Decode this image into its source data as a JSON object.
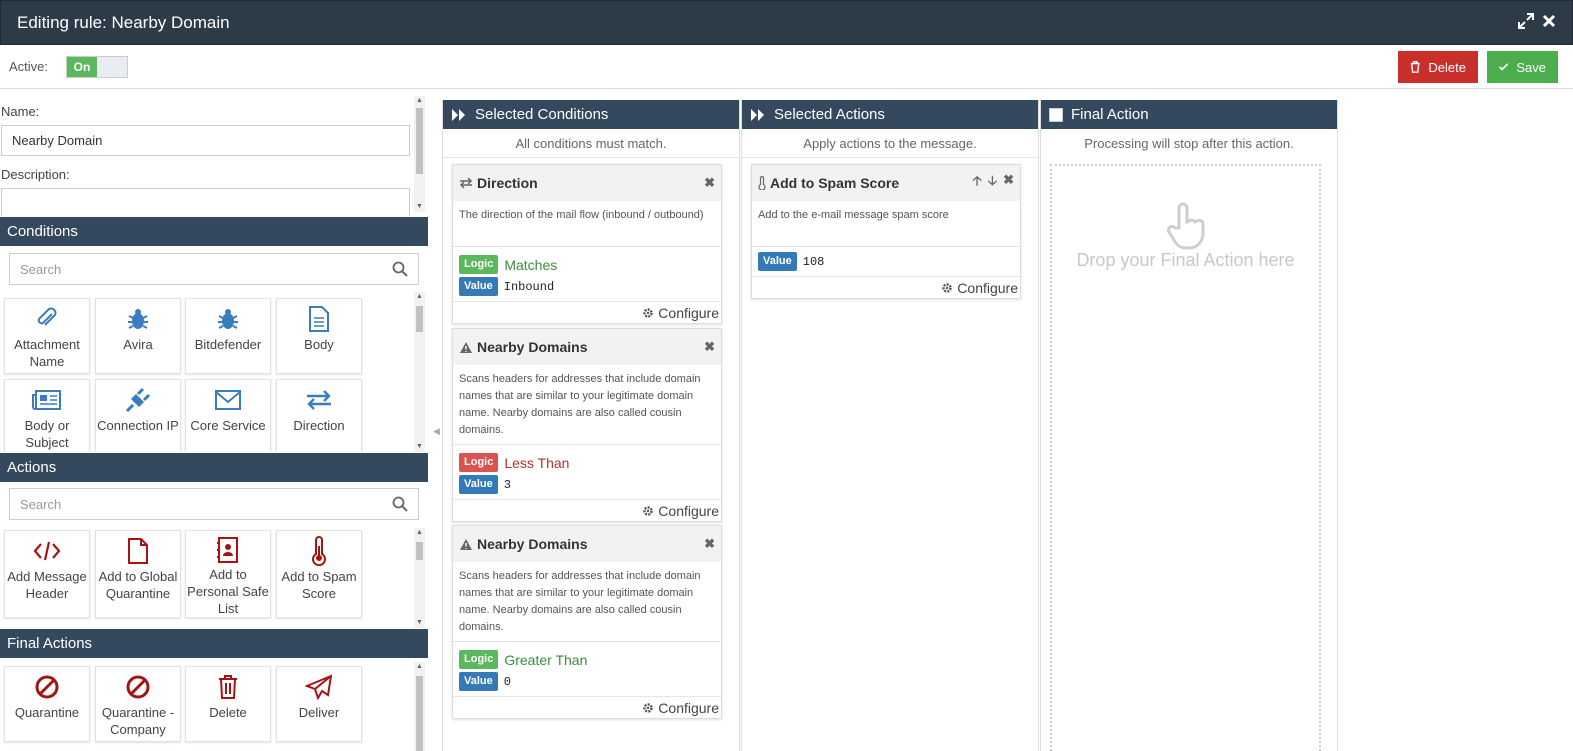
{
  "header": {
    "title": "Editing rule: Nearby Domain"
  },
  "toolbar": {
    "active_label": "Active:",
    "toggle_on": "On",
    "delete_label": "Delete",
    "save_label": "Save"
  },
  "form": {
    "name_label": "Name:",
    "name_value": "Nearby Domain",
    "description_label": "Description:",
    "description_value": ""
  },
  "conditions": {
    "heading": "Conditions",
    "search_placeholder": "Search",
    "tiles": [
      {
        "icon": "paperclip-icon",
        "label": "Attachment Name"
      },
      {
        "icon": "bug-icon",
        "label": "Avira"
      },
      {
        "icon": "bug-icon",
        "label": "Bitdefender"
      },
      {
        "icon": "document-icon",
        "label": "Body"
      },
      {
        "icon": "newspaper-icon",
        "label": "Body or Subject"
      },
      {
        "icon": "plug-icon",
        "label": "Connection IP"
      },
      {
        "icon": "envelope-icon",
        "label": "Core Service"
      },
      {
        "icon": "exchange-icon",
        "label": "Direction"
      }
    ]
  },
  "actions": {
    "heading": "Actions",
    "search_placeholder": "Search",
    "tiles": [
      {
        "icon": "code-icon",
        "label": "Add Message Header"
      },
      {
        "icon": "file-icon",
        "label": "Add to Global Quarantine"
      },
      {
        "icon": "address-book-icon",
        "label": "Add to Personal Safe List"
      },
      {
        "icon": "thermometer-icon",
        "label": "Add to Spam Score"
      }
    ]
  },
  "final_actions": {
    "heading": "Final Actions",
    "tiles": [
      {
        "icon": "ban-icon",
        "label": "Quarantine"
      },
      {
        "icon": "ban-icon",
        "label": "Quarantine - Company"
      },
      {
        "icon": "trash-icon",
        "label": "Delete"
      },
      {
        "icon": "paper-plane-icon",
        "label": "Deliver"
      }
    ]
  },
  "selected_conditions": {
    "heading": "Selected Conditions",
    "subheading": "All conditions must match.",
    "cards": [
      {
        "title": "Direction",
        "icon": "exchange-icon",
        "description": "The direction of the mail flow (inbound / outbound)",
        "logic_badge": "Logic",
        "logic": "Matches",
        "logic_color": "#5cb85c",
        "value_badge": "Value",
        "value": "Inbound",
        "configure": "Configure"
      },
      {
        "title": "Nearby Domains",
        "icon": "warning-icon",
        "description": "Scans headers for addresses that include domain names that are similar to your legitimate domain name. Nearby domains are also called cousin domains.",
        "logic_badge": "Logic",
        "logic": "Less Than",
        "logic_color": "#d9534f",
        "value_badge": "Value",
        "value": "3",
        "configure": "Configure"
      },
      {
        "title": "Nearby Domains",
        "icon": "warning-icon",
        "description": "Scans headers for addresses that include domain names that are similar to your legitimate domain name. Nearby domains are also called cousin domains.",
        "logic_badge": "Logic",
        "logic": "Greater Than",
        "logic_color": "#5cb85c",
        "value_badge": "Value",
        "value": "0",
        "configure": "Configure"
      }
    ]
  },
  "selected_actions": {
    "heading": "Selected Actions",
    "subheading": "Apply actions to the message.",
    "cards": [
      {
        "title": "Add to Spam Score",
        "icon": "thermometer-icon",
        "description": "Add to the e-mail message spam score",
        "value_badge": "Value",
        "value": "108",
        "configure": "Configure"
      }
    ]
  },
  "final_action": {
    "heading": "Final Action",
    "subheading": "Processing will stop after this action.",
    "dropzone_text": "Drop your Final Action here"
  },
  "colors": {
    "header_bg": "#2d3b48",
    "section_bg": "#34495e",
    "delete": "#c9302c",
    "save": "#4cae4c",
    "condition_icon": "#3a7dbd",
    "action_icon": "#a31515"
  }
}
